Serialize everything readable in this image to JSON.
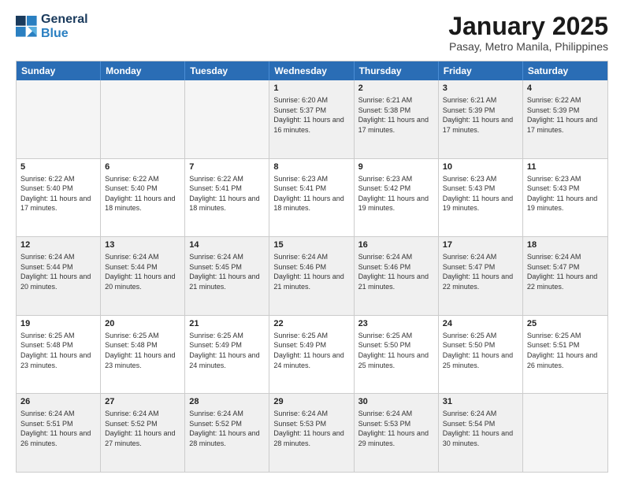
{
  "logo": {
    "line1": "General",
    "line2": "Blue"
  },
  "title": "January 2025",
  "subtitle": "Pasay, Metro Manila, Philippines",
  "weekdays": [
    "Sunday",
    "Monday",
    "Tuesday",
    "Wednesday",
    "Thursday",
    "Friday",
    "Saturday"
  ],
  "weeks": [
    [
      {
        "day": "",
        "info": ""
      },
      {
        "day": "",
        "info": ""
      },
      {
        "day": "",
        "info": ""
      },
      {
        "day": "1",
        "info": "Sunrise: 6:20 AM\nSunset: 5:37 PM\nDaylight: 11 hours and 16 minutes."
      },
      {
        "day": "2",
        "info": "Sunrise: 6:21 AM\nSunset: 5:38 PM\nDaylight: 11 hours and 17 minutes."
      },
      {
        "day": "3",
        "info": "Sunrise: 6:21 AM\nSunset: 5:39 PM\nDaylight: 11 hours and 17 minutes."
      },
      {
        "day": "4",
        "info": "Sunrise: 6:22 AM\nSunset: 5:39 PM\nDaylight: 11 hours and 17 minutes."
      }
    ],
    [
      {
        "day": "5",
        "info": "Sunrise: 6:22 AM\nSunset: 5:40 PM\nDaylight: 11 hours and 17 minutes."
      },
      {
        "day": "6",
        "info": "Sunrise: 6:22 AM\nSunset: 5:40 PM\nDaylight: 11 hours and 18 minutes."
      },
      {
        "day": "7",
        "info": "Sunrise: 6:22 AM\nSunset: 5:41 PM\nDaylight: 11 hours and 18 minutes."
      },
      {
        "day": "8",
        "info": "Sunrise: 6:23 AM\nSunset: 5:41 PM\nDaylight: 11 hours and 18 minutes."
      },
      {
        "day": "9",
        "info": "Sunrise: 6:23 AM\nSunset: 5:42 PM\nDaylight: 11 hours and 19 minutes."
      },
      {
        "day": "10",
        "info": "Sunrise: 6:23 AM\nSunset: 5:43 PM\nDaylight: 11 hours and 19 minutes."
      },
      {
        "day": "11",
        "info": "Sunrise: 6:23 AM\nSunset: 5:43 PM\nDaylight: 11 hours and 19 minutes."
      }
    ],
    [
      {
        "day": "12",
        "info": "Sunrise: 6:24 AM\nSunset: 5:44 PM\nDaylight: 11 hours and 20 minutes."
      },
      {
        "day": "13",
        "info": "Sunrise: 6:24 AM\nSunset: 5:44 PM\nDaylight: 11 hours and 20 minutes."
      },
      {
        "day": "14",
        "info": "Sunrise: 6:24 AM\nSunset: 5:45 PM\nDaylight: 11 hours and 21 minutes."
      },
      {
        "day": "15",
        "info": "Sunrise: 6:24 AM\nSunset: 5:46 PM\nDaylight: 11 hours and 21 minutes."
      },
      {
        "day": "16",
        "info": "Sunrise: 6:24 AM\nSunset: 5:46 PM\nDaylight: 11 hours and 21 minutes."
      },
      {
        "day": "17",
        "info": "Sunrise: 6:24 AM\nSunset: 5:47 PM\nDaylight: 11 hours and 22 minutes."
      },
      {
        "day": "18",
        "info": "Sunrise: 6:24 AM\nSunset: 5:47 PM\nDaylight: 11 hours and 22 minutes."
      }
    ],
    [
      {
        "day": "19",
        "info": "Sunrise: 6:25 AM\nSunset: 5:48 PM\nDaylight: 11 hours and 23 minutes."
      },
      {
        "day": "20",
        "info": "Sunrise: 6:25 AM\nSunset: 5:48 PM\nDaylight: 11 hours and 23 minutes."
      },
      {
        "day": "21",
        "info": "Sunrise: 6:25 AM\nSunset: 5:49 PM\nDaylight: 11 hours and 24 minutes."
      },
      {
        "day": "22",
        "info": "Sunrise: 6:25 AM\nSunset: 5:49 PM\nDaylight: 11 hours and 24 minutes."
      },
      {
        "day": "23",
        "info": "Sunrise: 6:25 AM\nSunset: 5:50 PM\nDaylight: 11 hours and 25 minutes."
      },
      {
        "day": "24",
        "info": "Sunrise: 6:25 AM\nSunset: 5:50 PM\nDaylight: 11 hours and 25 minutes."
      },
      {
        "day": "25",
        "info": "Sunrise: 6:25 AM\nSunset: 5:51 PM\nDaylight: 11 hours and 26 minutes."
      }
    ],
    [
      {
        "day": "26",
        "info": "Sunrise: 6:24 AM\nSunset: 5:51 PM\nDaylight: 11 hours and 26 minutes."
      },
      {
        "day": "27",
        "info": "Sunrise: 6:24 AM\nSunset: 5:52 PM\nDaylight: 11 hours and 27 minutes."
      },
      {
        "day": "28",
        "info": "Sunrise: 6:24 AM\nSunset: 5:52 PM\nDaylight: 11 hours and 28 minutes."
      },
      {
        "day": "29",
        "info": "Sunrise: 6:24 AM\nSunset: 5:53 PM\nDaylight: 11 hours and 28 minutes."
      },
      {
        "day": "30",
        "info": "Sunrise: 6:24 AM\nSunset: 5:53 PM\nDaylight: 11 hours and 29 minutes."
      },
      {
        "day": "31",
        "info": "Sunrise: 6:24 AM\nSunset: 5:54 PM\nDaylight: 11 hours and 30 minutes."
      },
      {
        "day": "",
        "info": ""
      }
    ]
  ],
  "shadedRows": [
    0,
    2,
    4
  ]
}
